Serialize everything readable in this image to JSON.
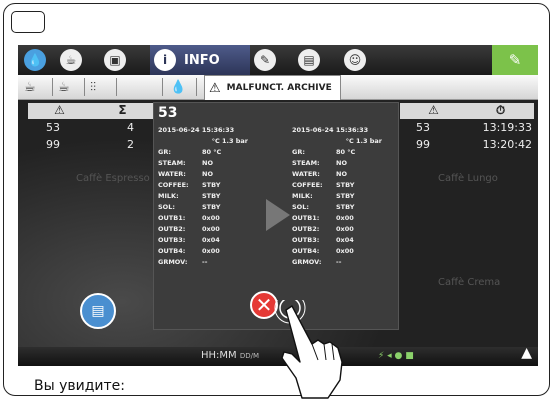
{
  "top_bar": {
    "info_label": "INFO",
    "icons": [
      "drop-icon",
      "cup-icon",
      "cup-alt-icon",
      "info-icon",
      "pencil-icon",
      "list-icon",
      "user-icon",
      "wrench-icon"
    ]
  },
  "sub_bar": {
    "archive_label": "MALFUNCT. ARCHIVE",
    "icons": [
      "cup-steam-icon",
      "cup-alt-icon",
      "sliders-icon",
      "drop-icon",
      "warning-icon"
    ]
  },
  "left_table": {
    "headers": [
      "⚠",
      "Σ"
    ],
    "rows": [
      {
        "code": "53",
        "count": "4"
      },
      {
        "code": "99",
        "count": "2"
      }
    ]
  },
  "right_table": {
    "headers": [
      "⚠",
      "⏱"
    ],
    "rows": [
      {
        "code": "53",
        "time": "13:19:33"
      },
      {
        "code": "99",
        "time": "13:20:42"
      }
    ]
  },
  "dialog": {
    "title": "53",
    "left": {
      "timestamp": "2015-06-24 15:36:33",
      "temp_press": "°C 1.3   bar",
      "gr": "80  °C",
      "steam": "NO",
      "water": "NO",
      "coffee": "STBY",
      "milk": "STBY",
      "sol": "STBY",
      "outb1": "0x00",
      "outb2": "0x00",
      "outb3": "0x04",
      "outb4": "0x00",
      "grmov": "--"
    },
    "right": {
      "timestamp": "2015-06-24 15:36:33",
      "temp_press": "°C 1.3   bar",
      "gr": "80  °C",
      "steam": "NO",
      "water": "NO",
      "coffee": "STBY",
      "milk": "STBY",
      "sol": "STBY",
      "outb1": "0x00",
      "outb2": "0x00",
      "outb3": "0x04",
      "outb4": "0x00",
      "grmov": "--"
    },
    "labels": {
      "gr": "GR:",
      "steam": "STEAM:",
      "water": "WATER:",
      "coffee": "COFFEE:",
      "milk": "MILK:",
      "sol": "SOL:",
      "outb1": "OUTB1:",
      "outb2": "OUTB2:",
      "outb3": "OUTB3:",
      "outb4": "OUTB4:",
      "grmov": "GRMOV:"
    }
  },
  "bottom_bar": {
    "clock": "HH:MM",
    "date": "DD/M"
  },
  "ghost_text": [
    "Caffè Espresso",
    "Caffè Lungo",
    "Caffè Crema"
  ],
  "caption": "Вы увидите:",
  "colors": {
    "accent_green": "#7cc24a",
    "info_blue": "#2d3558",
    "close_red": "#e53935",
    "fab_blue": "#4a8fd0"
  }
}
